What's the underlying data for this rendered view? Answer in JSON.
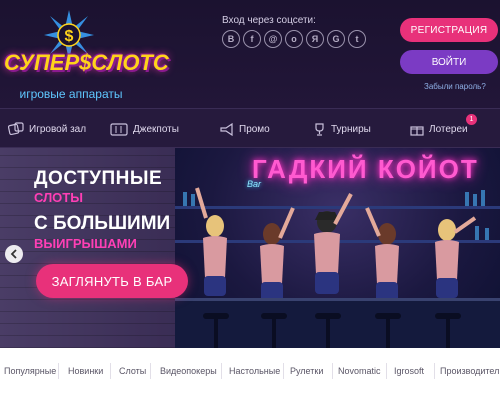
{
  "header": {
    "logo_text": "СУПЕР$СЛОТС",
    "logo_subtitle": "игровые аппараты",
    "social_label": "Вход через соцсети:",
    "social_icons": [
      "vk-icon",
      "facebook-icon",
      "mailru-icon",
      "odnoklassniki-icon",
      "yandex-icon",
      "google-icon",
      "twitter-icon"
    ],
    "social_glyphs": [
      "В",
      "f",
      "@",
      "о",
      "Я",
      "G",
      "t"
    ],
    "register_label": "РЕГИСТРАЦИЯ",
    "login_label": "ВОЙТИ",
    "forgot_label": "Забыли пароль?"
  },
  "nav": {
    "items": [
      {
        "label": "Игровой зал",
        "icon": "dice-icon"
      },
      {
        "label": "Джекпоты",
        "icon": "slot-machine-icon"
      },
      {
        "label": "Промо",
        "icon": "megaphone-icon"
      },
      {
        "label": "Турниры",
        "icon": "trophy-icon"
      },
      {
        "label": "Лотереи",
        "icon": "gift-icon"
      }
    ],
    "lottery_badge": "1"
  },
  "banner": {
    "neon_title": "ГАДКИЙ КОЙОТ",
    "neon_sub": "Bar",
    "line1": "ДОСТУПНЫЕ",
    "line2": "СЛОТЫ",
    "line3": "С БОЛЬШИМИ",
    "line4": "ВЫИГРЫШАМИ",
    "cta_label": "ЗАГЛЯНУТЬ В БАР"
  },
  "categories": [
    "Популярные",
    "Новинки",
    "Слоты",
    "Видеопокеры",
    "Настольные",
    "Рулетки",
    "Novomatic",
    "Igrosoft",
    "Производители"
  ],
  "colors": {
    "accent_pink": "#e8317a",
    "accent_purple": "#7b3bc4",
    "background": "#1c1230"
  }
}
